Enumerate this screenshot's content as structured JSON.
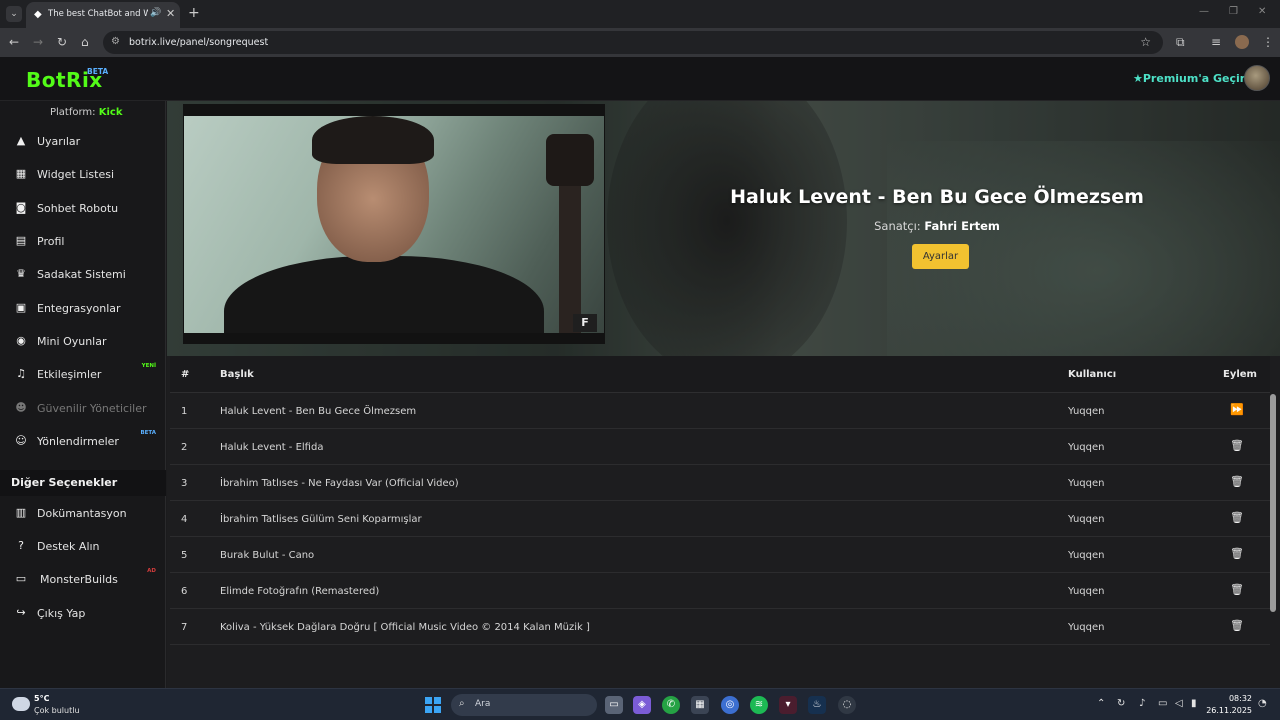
{
  "browser": {
    "tab_title": "The best ChatBot and Widg",
    "url": "botrix.live/panel/songrequest"
  },
  "header": {
    "logo": "BotRix",
    "logo_badge": "BETA",
    "premium_label": "Premium'a Geçin"
  },
  "sidebar": {
    "platform_label": "Platform:",
    "platform_value": "Kick",
    "items": [
      {
        "label": "Uyarılar",
        "icon": "warning-icon"
      },
      {
        "label": "Widget Listesi",
        "icon": "grid-icon"
      },
      {
        "label": "Sohbet Robotu",
        "icon": "robot-icon"
      },
      {
        "label": "Profil",
        "icon": "id-card-icon"
      },
      {
        "label": "Sadakat Sistemi",
        "icon": "trophy-icon"
      },
      {
        "label": "Entegrasyonlar",
        "icon": "plug-icon"
      },
      {
        "label": "Mini Oyunlar",
        "icon": "gamepad-icon"
      },
      {
        "label": "Etkileşimler",
        "icon": "music-icon",
        "badge": "YENİ"
      },
      {
        "label": "Güvenilir Yöneticiler",
        "icon": "users-icon"
      },
      {
        "label": "Yönlendirmeler",
        "icon": "user-group-icon",
        "badge": "BETA"
      }
    ],
    "other_title": "Diğer Seçenekler",
    "other_items": [
      {
        "label": "Dokümantasyon",
        "icon": "book-icon"
      },
      {
        "label": "Destek Alın",
        "icon": "question-icon"
      },
      {
        "label": "MonsterBuilds",
        "icon": "laptop-icon",
        "badge": "AD"
      },
      {
        "label": "Çıkış Yap",
        "icon": "logout-icon"
      }
    ]
  },
  "now_playing": {
    "title": "Haluk Levent - Ben Bu Gece Ölmezsem",
    "artist_label": "Sanatçı:",
    "artist": "Fahri Ertem",
    "settings_button": "Ayarlar",
    "thumb_badge": "F"
  },
  "queue": {
    "headers": {
      "num": "#",
      "title": "Başlık",
      "user": "Kullanıcı",
      "action": "Eylem"
    },
    "rows": [
      {
        "num": "1",
        "title": "Haluk Levent - Ben Bu Gece Ölmezsem",
        "user": "Yuqqen",
        "action": "skip"
      },
      {
        "num": "2",
        "title": "Haluk Levent - Elfida",
        "user": "Yuqqen",
        "action": "delete"
      },
      {
        "num": "3",
        "title": "İbrahim Tatlıses - Ne Faydası Var (Official Video)",
        "user": "Yuqqen",
        "action": "delete"
      },
      {
        "num": "4",
        "title": "İbrahim Tatlises Gülüm Seni Koparmışlar",
        "user": "Yuqqen",
        "action": "delete"
      },
      {
        "num": "5",
        "title": "Burak Bulut - Cano",
        "user": "Yuqqen",
        "action": "delete"
      },
      {
        "num": "6",
        "title": "Elimde Fotoğrafın (Remastered)",
        "user": "Yuqqen",
        "action": "delete"
      },
      {
        "num": "7",
        "title": "Koliva - Yüksek Dağlara Doğru [ Official Music Video © 2014 Kalan Müzik ]",
        "user": "Yuqqen",
        "action": "delete"
      }
    ]
  },
  "taskbar": {
    "temp": "5°C",
    "weather": "Çok bulutlu",
    "search_placeholder": "Ara",
    "time": "08:32",
    "date": "26.11.2025"
  },
  "colors": {
    "brand_green": "#53fc18",
    "premium": "#4de1c7",
    "button_yellow": "#f2c230"
  }
}
